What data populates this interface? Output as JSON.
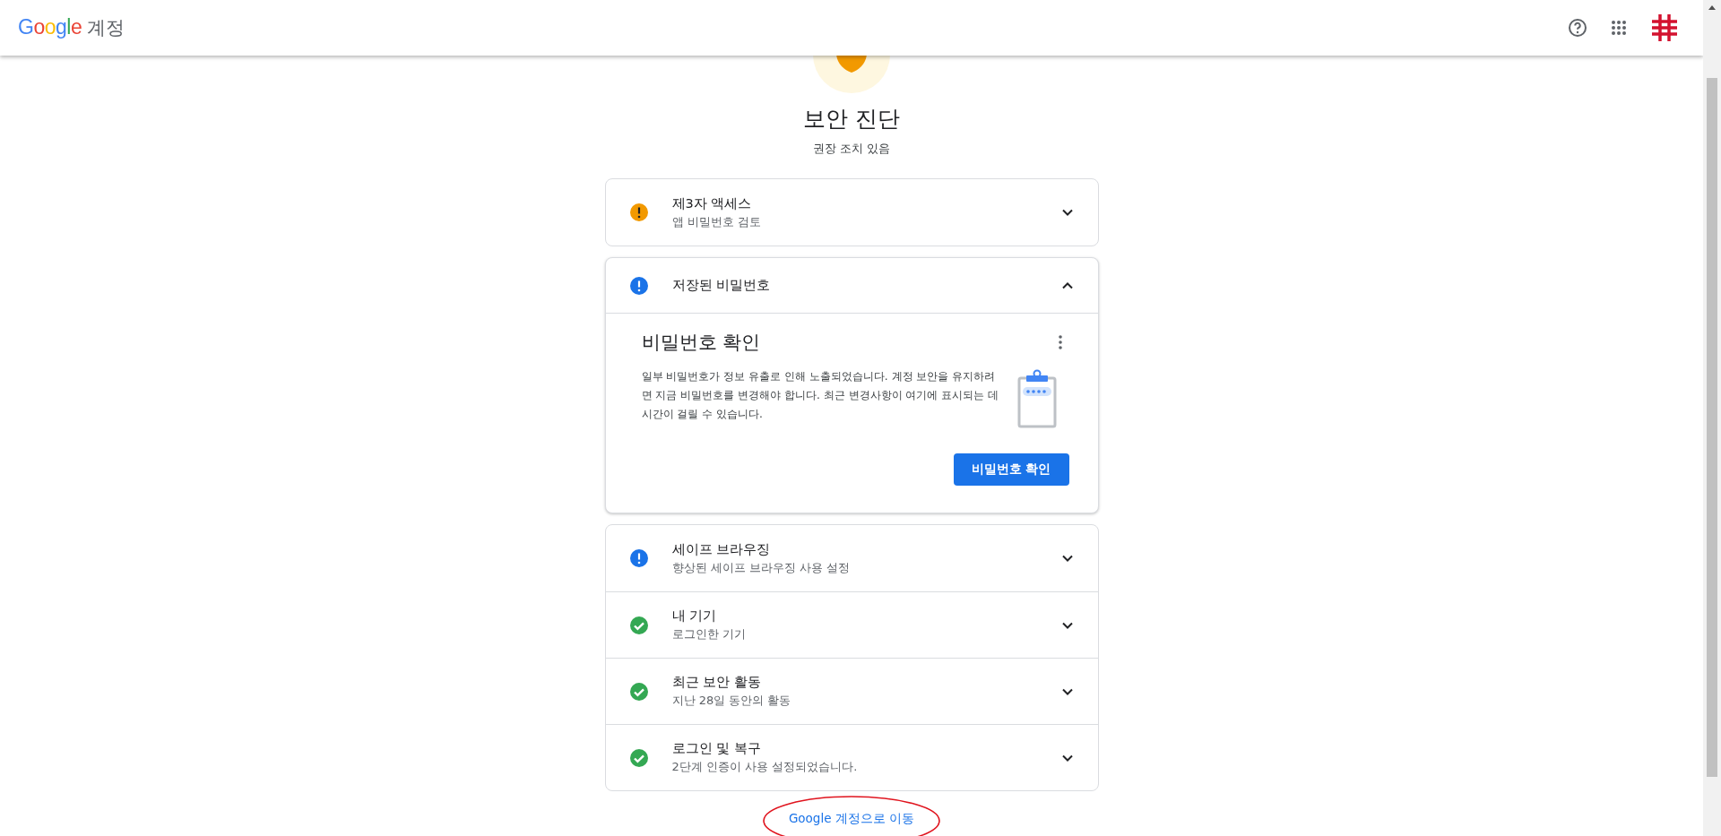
{
  "header": {
    "logo": "Google",
    "product": "계정"
  },
  "page": {
    "title": "보안 진단",
    "subtitle": "권장 조치 있음"
  },
  "cards": [
    {
      "items": [
        {
          "kind": "warning",
          "title": "제3자 액세스",
          "subtitle": "앱 비밀번호 검토",
          "expanded": false
        }
      ]
    },
    {
      "items": [
        {
          "kind": "info",
          "title": "저장된 비밀번호",
          "expanded": true,
          "detail": {
            "title": "비밀번호 확인",
            "text": "일부 비밀번호가 정보 유출로 인해 노출되었습니다. 계정 보안을 유지하려면 지금 비밀번호를 변경해야 합니다. 최근 변경사항이 여기에 표시되는 데 시간이 걸릴 수 있습니다.",
            "button": "비밀번호 확인"
          }
        }
      ]
    },
    {
      "items": [
        {
          "kind": "info",
          "title": "세이프 브라우징",
          "subtitle": "향상된 세이프 브라우징 사용 설정",
          "expanded": false
        },
        {
          "kind": "ok",
          "title": "내 기기",
          "subtitle": "로그인한 기기",
          "expanded": false
        },
        {
          "kind": "ok",
          "title": "최근 보안 활동",
          "subtitle": "지난 28일 동안의 활동",
          "expanded": false
        },
        {
          "kind": "ok",
          "title": "로그인 및 복구",
          "subtitle": "2단계 인증이 사용 설정되었습니다.",
          "expanded": false
        }
      ]
    }
  ],
  "link": "Google 계정으로 이동"
}
